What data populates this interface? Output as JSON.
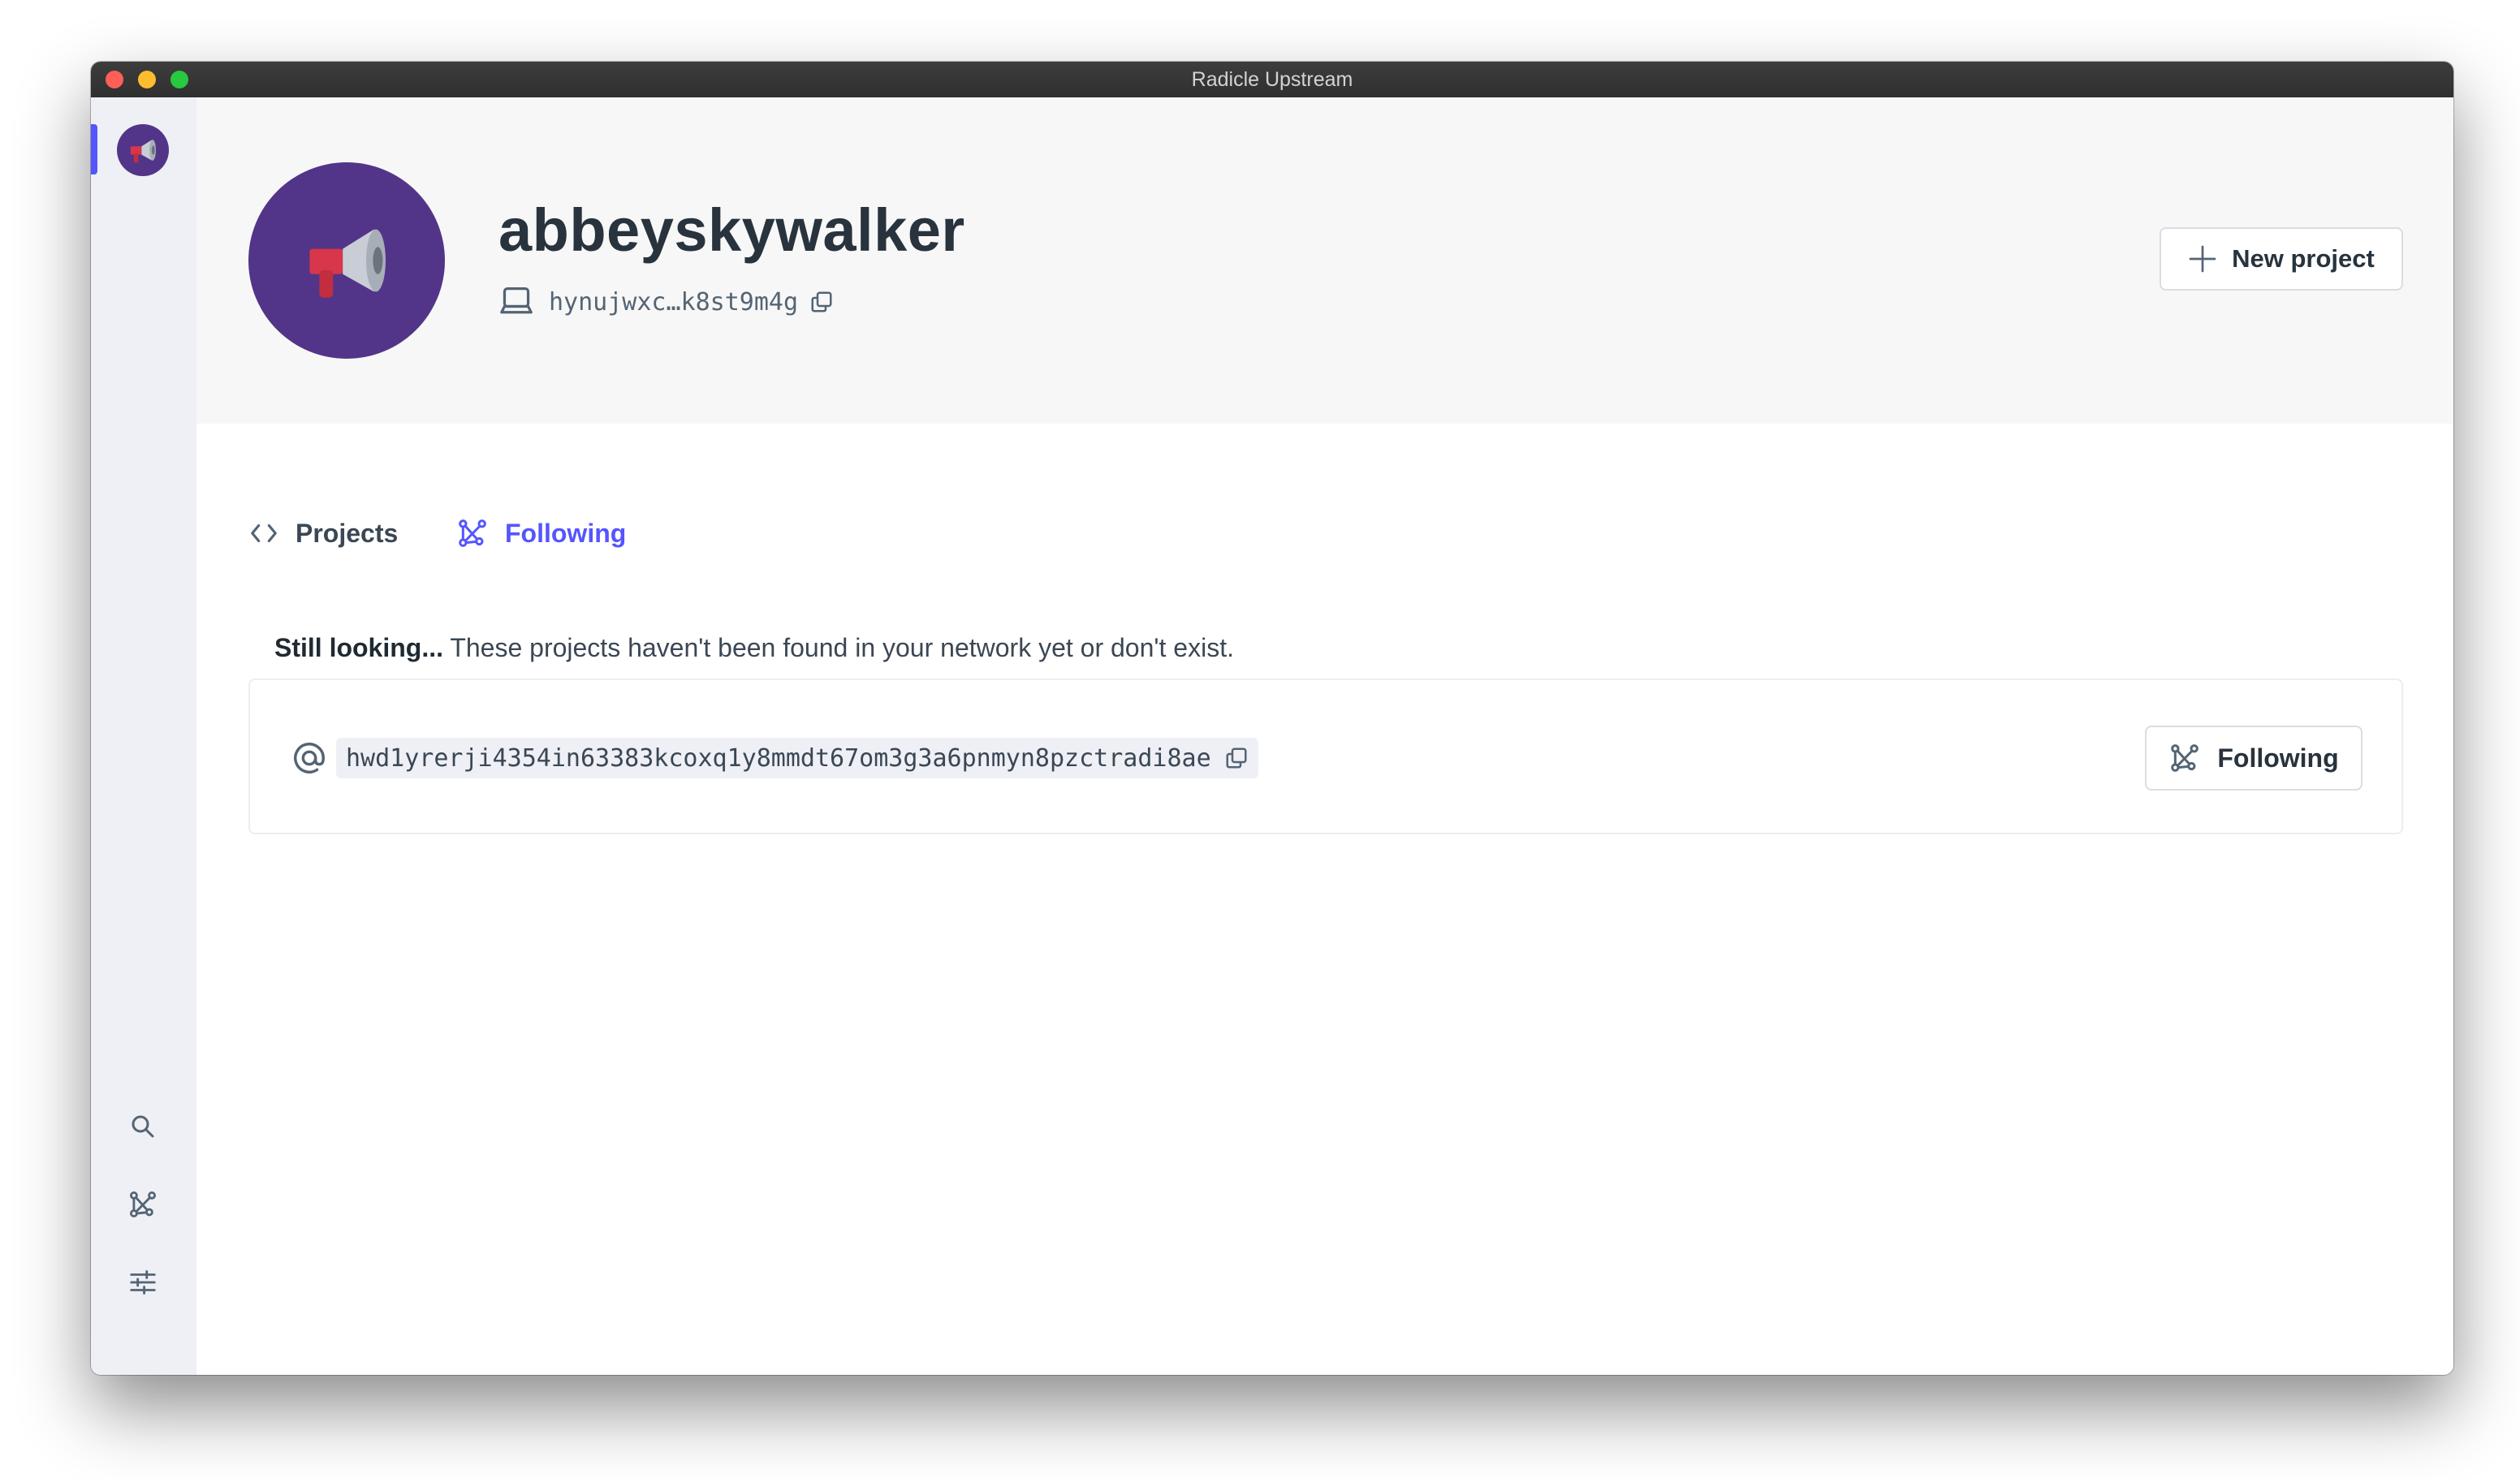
{
  "window": {
    "title": "Radicle Upstream"
  },
  "sidebar": {
    "avatar_icon": "megaphone-icon",
    "items": [
      {
        "name": "search",
        "icon": "search-icon"
      },
      {
        "name": "network",
        "icon": "network-icon"
      },
      {
        "name": "settings",
        "icon": "settings-icon"
      }
    ]
  },
  "profile": {
    "name": "abbeyskywalker",
    "peer_id": "hynujwxc…k8st9m4g",
    "avatar_icon": "megaphone-icon"
  },
  "header": {
    "new_project_label": "New project"
  },
  "tabs": [
    {
      "label": "Projects",
      "icon": "code-icon",
      "active": false
    },
    {
      "label": "Following",
      "icon": "network-icon",
      "active": true
    }
  ],
  "notice": {
    "bold": "Still looking...",
    "text": " These projects haven't been found in your network yet or don't exist."
  },
  "projects": [
    {
      "urn": "hwd1yrerji4354in63383kcoxq1y8mmdt67om3g3a6pnmyn8pzctradi8ae",
      "button_label": "Following"
    }
  ],
  "colors": {
    "accent": "#5555ff",
    "avatar_bg": "#523589",
    "sidebar_bg": "#eef0f5",
    "header_bg": "#f7f7f7"
  }
}
